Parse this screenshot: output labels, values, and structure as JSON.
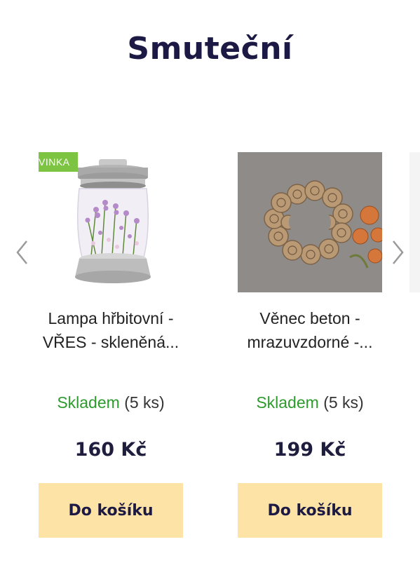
{
  "section": {
    "title": "Smuteční"
  },
  "products": [
    {
      "badge": "NOVINKA",
      "name_line1": "Lampa hřbitovní -",
      "name_line2": "VŘES - skleněná...",
      "stock_label": "Skladem",
      "stock_count": "(5 ks)",
      "price": "160 Kč",
      "button_label": "Do košíku"
    },
    {
      "name_line1": "Věnec beton -",
      "name_line2": "mrazuvzdorné -...",
      "stock_label": "Skladem",
      "stock_count": "(5 ks)",
      "price": "199 Kč",
      "button_label": "Do košíku"
    }
  ],
  "colors": {
    "title": "#1c1a44",
    "badge": "#7dc443",
    "stock": "#2e9a2e",
    "button": "#fde3a5"
  },
  "icons": {
    "prev": "chevron-left-icon",
    "next": "chevron-right-icon"
  }
}
